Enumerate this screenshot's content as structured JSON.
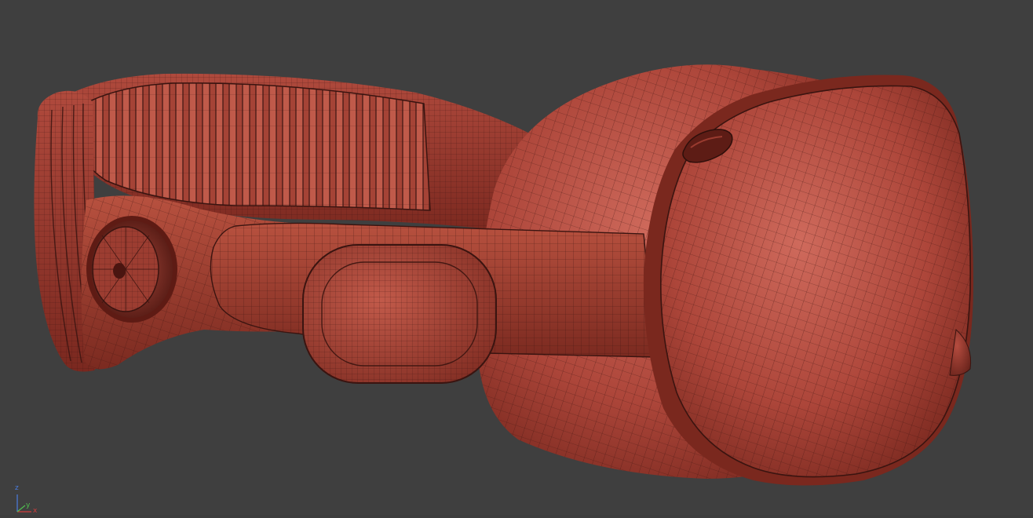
{
  "viewport": {
    "background_color": "#3f3f3f",
    "shading": "wireframe-on-shaded",
    "model_color": "#b34a3c",
    "wire_color": "#3a1410"
  },
  "axis_gizmo": {
    "x_label": "x",
    "y_label": "y",
    "z_label": "z",
    "x_color": "#d23c3c",
    "y_color": "#4fc04f",
    "z_color": "#4a7de0"
  }
}
